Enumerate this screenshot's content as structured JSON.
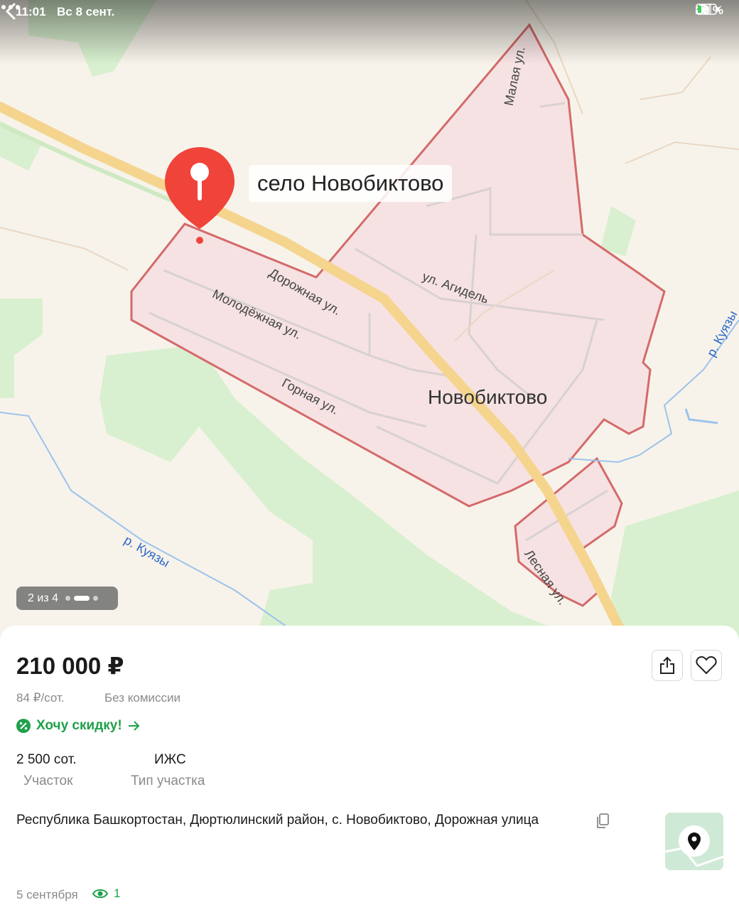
{
  "status_bar": {
    "time": "11:01",
    "date": "Вс 8 сент.",
    "battery": "13 %"
  },
  "map": {
    "pin_label": "село Новобиктово",
    "city_label": "Новобиктово",
    "streets": [
      "Малая ул.",
      "Дорожная ул.",
      "ул. Агидель",
      "Молодёжная ул.",
      "Горная ул.",
      "Лесная ул."
    ],
    "rivers": [
      "р. Куязы",
      "р. Куязы"
    ],
    "colors": {
      "settlement_fill": "#f6e2e2",
      "settlement_border": "#d46a6a",
      "forest": "#d8f0cf",
      "road": "#f5d48e",
      "pin": "#f0433a"
    }
  },
  "gallery": {
    "counter": "2 из 4",
    "current_index": 2,
    "total": 4
  },
  "listing": {
    "price": "210 000 ₽",
    "price_per_unit": "84 ₽/сот.",
    "commission": "Без комиссии",
    "discount_link": "Хочу скидку!",
    "facts": [
      {
        "value": "2 500 сот.",
        "label": "Участок"
      },
      {
        "value": "ИЖС",
        "label": "Тип участка"
      }
    ],
    "address": "Республика Башкортостан, Дюртюлинский район, с. Новобиктово, Дорожная улица",
    "posted_date": "5 сентября",
    "views": "1"
  },
  "icons": [
    "back-arrow-icon",
    "more-icon",
    "share-icon",
    "heart-icon",
    "discount-icon",
    "arrow-right-icon",
    "copy-icon",
    "map-pin-icon",
    "eye-icon",
    "wifi-icon",
    "signal-icon",
    "battery-icon",
    "location-arrow-icon"
  ],
  "accent_color": "#1fa04a"
}
